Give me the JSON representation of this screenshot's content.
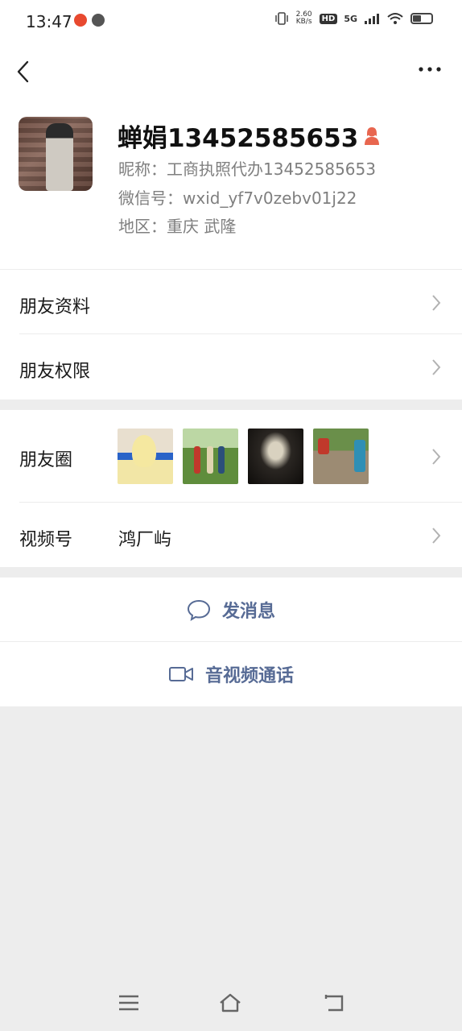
{
  "status_bar": {
    "time": "13:47",
    "speed_value": "2.60",
    "speed_unit": "KB/s",
    "hd": "HD",
    "network": "5G"
  },
  "profile": {
    "name": "蝉娟13452585653",
    "nickname": "昵称：工商执照代办13452585653",
    "wechat_id": "微信号：wxid_yf7v0zebv01j22",
    "region": "地区：重庆  武隆"
  },
  "cells": {
    "friend_info": "朋友资料",
    "friend_permissions": "朋友权限",
    "moments": "朋友圈",
    "channels": "视频号",
    "channels_value": "鸿厂屿"
  },
  "actions": {
    "message": "发消息",
    "call": "音视频通话"
  },
  "colors": {
    "link": "#576b95",
    "background": "#ededed",
    "gender_female": "#e8664f"
  }
}
